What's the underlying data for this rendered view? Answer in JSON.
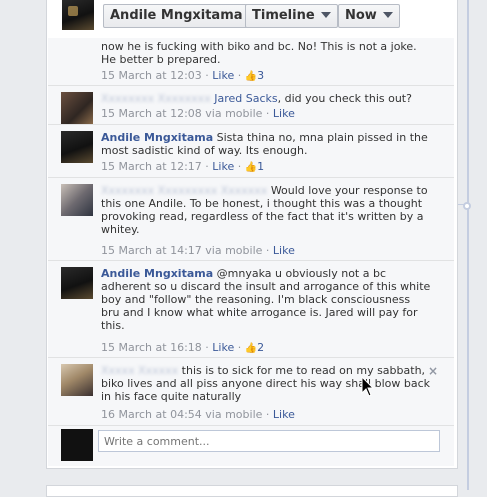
{
  "header": {
    "profile_name": "Andile Mngxitama",
    "timeline_label": "Timeline",
    "now_label": "Now"
  },
  "comments": [
    {
      "author": "",
      "text": "now he is fucking with biko and bc. No! This is not a joke. He better b prepared.",
      "time": "15 March at 12:03",
      "via": "",
      "like_label": "Like",
      "like_count": "3"
    },
    {
      "author": "Xxxxxxxx Xxxxxxxx",
      "tag": "Jared Sacks",
      "text": ", did you check this out?",
      "time": "15 March at 12:08",
      "via": "via mobile",
      "like_label": "Like",
      "like_count": ""
    },
    {
      "author": "Andile Mngxitama",
      "text": "Sista thina no, mna plain pissed in the most sadistic kind of way. Its enough.",
      "time": "15 March at 12:17",
      "via": "",
      "like_label": "Like",
      "like_count": "1"
    },
    {
      "author": "Xxxxxxxx Xxxxxxxxx Xxxxxxx",
      "text": "Would love your response to this one Andile. To be honest, i thought this was a thought provoking read, regardless of the fact that it's written by a whitey.",
      "time": "15 March at 14:17",
      "via": "via mobile",
      "like_label": "Like",
      "like_count": ""
    },
    {
      "author": "Andile Mngxitama",
      "text": "@mnyaka u obviously not a bc adherent so u discard the insult and arrogance of this white boy and \"follow\" the reasoning. I'm black consciousness bru and I know what white arrogance is. Jared will pay for this.",
      "time": "15 March at 16:18",
      "via": "",
      "like_label": "Like",
      "like_count": "2"
    },
    {
      "author": "Xxxxx Xxxxxx",
      "text": "this is to sick for me to read on my sabbath, biko lives and all piss anyone direct his way shall blow back in his face quite naturally",
      "time": "16 March at 04:54",
      "via": "via mobile",
      "like_label": "Like",
      "like_count": "",
      "close": "×"
    }
  ],
  "composer": {
    "placeholder": "Write a comment..."
  }
}
